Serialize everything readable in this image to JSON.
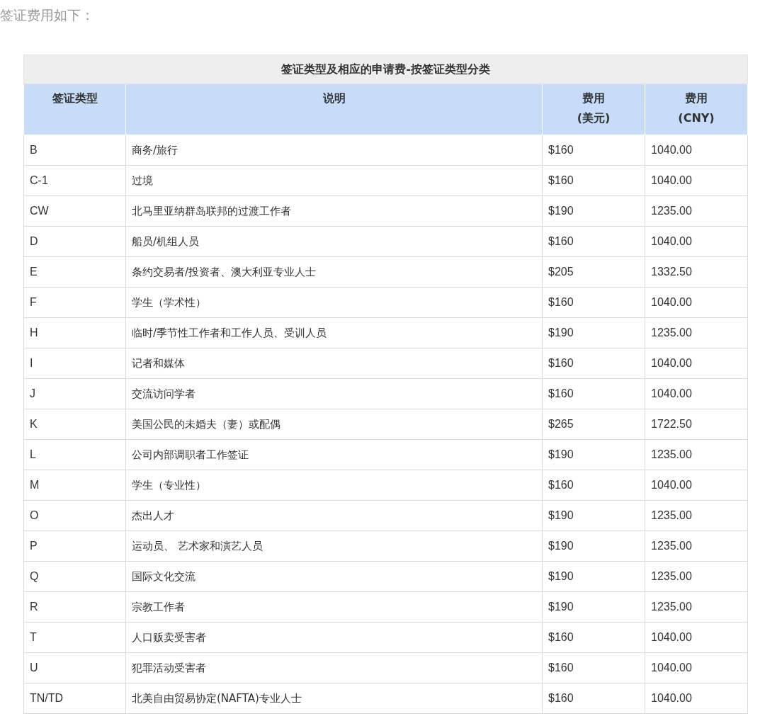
{
  "intro": "签证费用如下：",
  "table": {
    "title": "签证类型及相应的申请费-按签证类型分类",
    "columns": [
      "签证类型",
      "说明",
      "费用\n(美元)",
      "费用\n(CNY)"
    ],
    "rows": [
      [
        "B",
        "商务/旅行",
        "$160",
        "1040.00"
      ],
      [
        "C-1",
        "过境",
        "$160",
        "1040.00"
      ],
      [
        "CW",
        "北马里亚纳群岛联邦的过渡工作者",
        "$190",
        "1235.00"
      ],
      [
        "D",
        "船员/机组人员",
        "$160",
        "1040.00"
      ],
      [
        "E",
        "条约交易者/投资者、澳大利亚专业人士",
        "$205",
        "1332.50"
      ],
      [
        "F",
        "学生（学术性）",
        "$160",
        "1040.00"
      ],
      [
        "H",
        "临时/季节性工作者和工作人员、受训人员",
        "$190",
        "1235.00"
      ],
      [
        "I",
        "记者和媒体",
        "$160",
        "1040.00"
      ],
      [
        "J",
        "交流访问学者",
        "$160",
        "1040.00"
      ],
      [
        "K",
        "美国公民的未婚夫（妻）或配偶",
        "$265",
        "1722.50"
      ],
      [
        "L",
        "公司内部调职者工作签证",
        "$190",
        "1235.00"
      ],
      [
        "M",
        "学生（专业性）",
        "$160",
        "1040.00"
      ],
      [
        "O",
        "杰出人才",
        "$190",
        "1235.00"
      ],
      [
        "P",
        "运动员、 艺术家和演艺人员",
        "$190",
        "1235.00"
      ],
      [
        "Q",
        "国际文化交流",
        "$190",
        "1235.00"
      ],
      [
        "R",
        "宗教工作者",
        "$190",
        "1235.00"
      ],
      [
        "T",
        "人口贩卖受害者",
        "$160",
        "1040.00"
      ],
      [
        "U",
        "犯罪活动受害者",
        "$160",
        "1040.00"
      ],
      [
        "TN/TD",
        "北美自由贸易协定(NAFTA)专业人士",
        "$160",
        "1040.00"
      ]
    ]
  }
}
